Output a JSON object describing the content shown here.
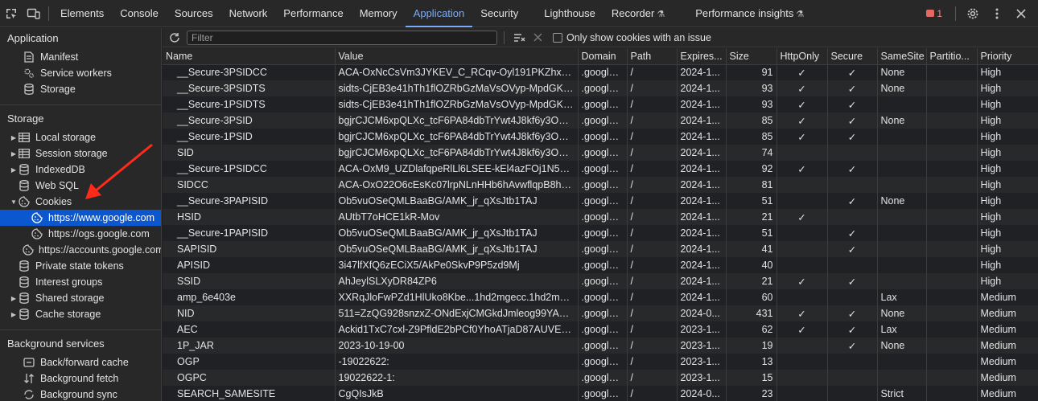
{
  "topbar": {
    "tabs": [
      "Elements",
      "Console",
      "Sources",
      "Network",
      "Performance",
      "Memory",
      "Application",
      "Security",
      "Lighthouse",
      "Recorder",
      "Performance insights"
    ],
    "active_tab": "Application",
    "flask_tabs": [
      "Recorder",
      "Performance insights"
    ],
    "error_count": "1"
  },
  "sidebar": {
    "application_title": "Application",
    "application_items": [
      "Manifest",
      "Service workers",
      "Storage"
    ],
    "storage_title": "Storage",
    "storage_items": [
      {
        "label": "Local storage",
        "expand": "right",
        "icon": "table-icon"
      },
      {
        "label": "Session storage",
        "expand": "right",
        "icon": "table-icon"
      },
      {
        "label": "IndexedDB",
        "expand": "right",
        "icon": "database-icon"
      },
      {
        "label": "Web SQL",
        "expand": "none",
        "icon": "database-icon"
      },
      {
        "label": "Cookies",
        "expand": "down",
        "icon": "cookie-icon"
      },
      {
        "label": "https://www.google.com",
        "expand": "child",
        "icon": "cookie-icon",
        "selected": true
      },
      {
        "label": "https://ogs.google.com",
        "expand": "child",
        "icon": "cookie-icon"
      },
      {
        "label": "https://accounts.google.com",
        "expand": "child",
        "icon": "cookie-icon"
      },
      {
        "label": "Private state tokens",
        "expand": "none",
        "icon": "database-icon"
      },
      {
        "label": "Interest groups",
        "expand": "none",
        "icon": "database-icon"
      },
      {
        "label": "Shared storage",
        "expand": "right",
        "icon": "database-icon"
      },
      {
        "label": "Cache storage",
        "expand": "right",
        "icon": "database-icon"
      }
    ],
    "background_title": "Background services",
    "background_items": [
      "Back/forward cache",
      "Background fetch",
      "Background sync"
    ]
  },
  "toolbar": {
    "filter_placeholder": "Filter",
    "only_issue_label": "Only show cookies with an issue"
  },
  "cookies": {
    "columns": [
      "Name",
      "Value",
      "Domain",
      "Path",
      "Expires...",
      "Size",
      "HttpOnly",
      "Secure",
      "SameSite",
      "Partitio...",
      "Priority"
    ],
    "rows": [
      [
        "__Secure-3PSIDCC",
        "ACA-OxNcCsVm3JYKEV_C_RCqv-Oyl191PKZhxN8...",
        ".google....",
        "/",
        "2024-1...",
        "91",
        "✓",
        "✓",
        "None",
        "",
        "High"
      ],
      [
        "__Secure-3PSIDTS",
        "sidts-CjEB3e41hTh1flOZRbGzMaVsOVyp-MpdGK6...",
        ".google....",
        "/",
        "2024-1...",
        "93",
        "✓",
        "✓",
        "None",
        "",
        "High"
      ],
      [
        "__Secure-1PSIDTS",
        "sidts-CjEB3e41hTh1flOZRbGzMaVsOVyp-MpdGK6...",
        ".google....",
        "/",
        "2024-1...",
        "93",
        "✓",
        "✓",
        "",
        "",
        "High"
      ],
      [
        "__Secure-3PSID",
        "bgjrCJCM6xpQLXc_tcF6PA84dbTrYwt4J8kf6y3OHv...",
        ".google....",
        "/",
        "2024-1...",
        "85",
        "✓",
        "✓",
        "None",
        "",
        "High"
      ],
      [
        "__Secure-1PSID",
        "bgjrCJCM6xpQLXc_tcF6PA84dbTrYwt4J8kf6y3OHv...",
        ".google....",
        "/",
        "2024-1...",
        "85",
        "✓",
        "✓",
        "",
        "",
        "High"
      ],
      [
        "SID",
        "bgjrCJCM6xpQLXc_tcF6PA84dbTrYwt4J8kf6y3OHv...",
        ".google....",
        "/",
        "2024-1...",
        "74",
        "",
        "",
        "",
        "",
        "High"
      ],
      [
        "__Secure-1PSIDCC",
        "ACA-OxM9_UZDlafqpeRlLl6LSEE-kEl4azFOj1N5A_...",
        ".google....",
        "/",
        "2024-1...",
        "92",
        "✓",
        "✓",
        "",
        "",
        "High"
      ],
      [
        "SIDCC",
        "ACA-OxO22O6cEsKc07lrpNLnHHb6hAvwflqpB8hV...",
        ".google....",
        "/",
        "2024-1...",
        "81",
        "",
        "",
        "",
        "",
        "High"
      ],
      [
        "__Secure-3PAPISID",
        "Ob5vuOSeQMLBaaBG/AMK_jr_qXsJtb1TAJ",
        ".google....",
        "/",
        "2024-1...",
        "51",
        "",
        "✓",
        "None",
        "",
        "High"
      ],
      [
        "HSID",
        "AUtbT7oHCE1kR-Mov",
        ".google....",
        "/",
        "2024-1...",
        "21",
        "✓",
        "",
        "",
        "",
        "High"
      ],
      [
        "__Secure-1PAPISID",
        "Ob5vuOSeQMLBaaBG/AMK_jr_qXsJtb1TAJ",
        ".google....",
        "/",
        "2024-1...",
        "51",
        "",
        "✓",
        "",
        "",
        "High"
      ],
      [
        "SAPISID",
        "Ob5vuOSeQMLBaaBG/AMK_jr_qXsJtb1TAJ",
        ".google....",
        "/",
        "2024-1...",
        "41",
        "",
        "✓",
        "",
        "",
        "High"
      ],
      [
        "APISID",
        "3i47lfXfQ6zECiX5/AkPe0SkvP9P5zd9Mj",
        ".google....",
        "/",
        "2024-1...",
        "40",
        "",
        "",
        "",
        "",
        "High"
      ],
      [
        "SSID",
        "AhJeylSLXyDR84ZP6",
        ".google....",
        "/",
        "2024-1...",
        "21",
        "✓",
        "✓",
        "",
        "",
        "High"
      ],
      [
        "amp_6e403e",
        "XXRqJloFwPZd1HlUko8Kbe...1hd2mgecc.1hd2mge...",
        ".google....",
        "/",
        "2024-1...",
        "60",
        "",
        "",
        "Lax",
        "",
        "Medium"
      ],
      [
        "NID",
        "511=ZzQG928snzxZ-ONdExjCMGkdJmleog99YApy...",
        ".google....",
        "/",
        "2024-0...",
        "431",
        "✓",
        "✓",
        "None",
        "",
        "Medium"
      ],
      [
        "AEC",
        "Ackid1TxC7cxl-Z9PfldE2bPCf0YhoATjaD87AUVEgE...",
        ".google....",
        "/",
        "2023-1...",
        "62",
        "✓",
        "✓",
        "Lax",
        "",
        "Medium"
      ],
      [
        "1P_JAR",
        "2023-10-19-00",
        ".google....",
        "/",
        "2023-1...",
        "19",
        "",
        "✓",
        "None",
        "",
        "Medium"
      ],
      [
        "OGP",
        "-19022622:",
        ".google....",
        "/",
        "2023-1...",
        "13",
        "",
        "",
        "",
        "",
        "Medium"
      ],
      [
        "OGPC",
        "19022622-1:",
        ".google....",
        "/",
        "2023-1...",
        "15",
        "",
        "",
        "",
        "",
        "Medium"
      ],
      [
        "SEARCH_SAMESITE",
        "CgQIsJkB",
        ".google....",
        "/",
        "2024-0...",
        "23",
        "",
        "",
        "Strict",
        "",
        "Medium"
      ]
    ]
  }
}
